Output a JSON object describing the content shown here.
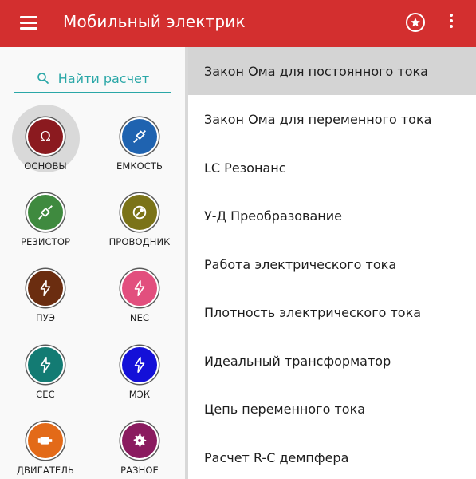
{
  "app_bar": {
    "title": "Мобильный электрик",
    "background": "#d32f2f",
    "menu_icon": "hamburger-menu-icon",
    "rate_icon": "star-circle-icon",
    "more_icon": "more-vertical-icon"
  },
  "search": {
    "placeholder": "Найти расчет",
    "icon": "search-icon",
    "accent": "#2aa7a7"
  },
  "categories": [
    {
      "label": "ОСНОВЫ",
      "icon": "omega-icon",
      "color": "#8b1a1f",
      "selected": true
    },
    {
      "label": "ЕМКОСТЬ",
      "icon": "capacitor-icon",
      "color": "#1f63b0",
      "selected": false
    },
    {
      "label": "РЕЗИСТОР",
      "icon": "resistor-icon",
      "color": "#3f8a3f",
      "selected": false
    },
    {
      "label": "ПРОВОДНИК",
      "icon": "wire-coil-icon",
      "color": "#7b7318",
      "selected": false
    },
    {
      "label": "ПУЭ",
      "icon": "lightning-icon",
      "color": "#6b2d10",
      "selected": false
    },
    {
      "label": "NEC",
      "icon": "lightning-icon",
      "color": "#e24f7e",
      "selected": false
    },
    {
      "label": "CEC",
      "icon": "lightning-icon",
      "color": "#137b73",
      "selected": false
    },
    {
      "label": "МЭК",
      "icon": "lightning-icon",
      "color": "#1410d8",
      "selected": false
    },
    {
      "label": "ДВИГАТЕЛЬ",
      "icon": "motor-icon",
      "color": "#e36a18",
      "selected": false
    },
    {
      "label": "РАЗНОЕ",
      "icon": "gear-icon",
      "color": "#8a1b5f",
      "selected": false
    }
  ],
  "calculations": [
    {
      "label": "Закон Ома для постоянного тока",
      "active": true
    },
    {
      "label": "Закон Ома для переменного тока",
      "active": false
    },
    {
      "label": "LC Резонанс",
      "active": false
    },
    {
      "label": "У-Д Преобразование",
      "active": false
    },
    {
      "label": "Работа электрического тока",
      "active": false
    },
    {
      "label": "Плотность электрического тока",
      "active": false
    },
    {
      "label": "Идеальный трансформатор",
      "active": false
    },
    {
      "label": "Цепь переменного тока",
      "active": false
    },
    {
      "label": "Расчет R-C демпфера",
      "active": false
    }
  ]
}
